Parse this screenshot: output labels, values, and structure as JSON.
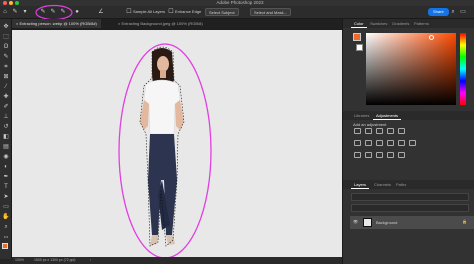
{
  "app_title": "Adobe Photoshop 2023",
  "options_bar": {
    "sample_all_layers": "Sample All Layers",
    "enhance_edge": "Enhance Edge",
    "select_subject": "Select Subject",
    "select_and_mask": "Select and Mask...",
    "share": "Share"
  },
  "tabs": [
    {
      "label": "Extracting person .webp @ 100% (RGB/8#)",
      "active": true
    },
    {
      "label": "Extracting Background.jpeg @ 100% (RGB/8)",
      "active": false
    }
  ],
  "status": {
    "zoom": "100%",
    "doc_size": "1500 px x 1300 px (72 ppi)"
  },
  "panels": {
    "color_tabs": [
      "Color",
      "Swatches",
      "Gradients",
      "Patterns"
    ],
    "libraries_tabs": [
      "Libraries",
      "Adjustments"
    ],
    "add_adjustment": "Add an adjustment",
    "layers_tabs": [
      "Layers",
      "Channels",
      "Paths"
    ],
    "layer_name": "Background"
  },
  "colors": {
    "foreground": "#ef6a2c",
    "accent": "#1473e6",
    "annotation": "#e040e0"
  }
}
